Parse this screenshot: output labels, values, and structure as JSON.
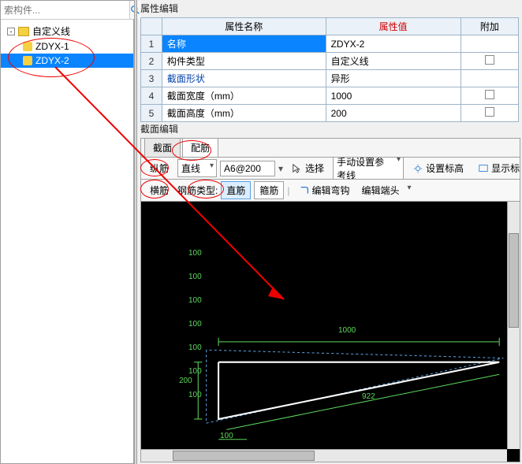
{
  "search": {
    "placeholder": "索构件..."
  },
  "tree": {
    "root_label": "自定义线",
    "children": [
      {
        "label": "ZDYX-1",
        "selected": false
      },
      {
        "label": "ZDYX-2",
        "selected": true
      }
    ]
  },
  "property_editor": {
    "title": "属性编辑",
    "headers": {
      "name": "属性名称",
      "value": "属性值",
      "extra": "附加"
    },
    "rows": [
      {
        "num": "1",
        "name": "名称",
        "value": "ZDYX-2",
        "selected": true,
        "has_checkbox": false
      },
      {
        "num": "2",
        "name": "构件类型",
        "value": "自定义线",
        "has_checkbox": true
      },
      {
        "num": "3",
        "name": "截面形状",
        "value": "异形",
        "link": true,
        "has_checkbox": false
      },
      {
        "num": "4",
        "name": "截面宽度（mm）",
        "value": "1000",
        "has_checkbox": true
      },
      {
        "num": "5",
        "name": "截面高度（mm）",
        "value": "200",
        "has_checkbox": true
      }
    ]
  },
  "section_editor": {
    "title": "截面编辑",
    "tabs": [
      {
        "label": "截面"
      },
      {
        "label": "配筋",
        "active": true
      }
    ],
    "toolbar1": {
      "rebar_vert": "纵筋",
      "line": "直线",
      "size_input": "A6@200",
      "select": "选择",
      "manual_ref": "手动设置参考线",
      "set_mark": "设置标高",
      "show_mark": "显示标"
    },
    "toolbar2": {
      "rebar_horz": "横筋",
      "rebar_type_label": "钢筋类型:",
      "straight": "直筋",
      "stirrup": "箍筋",
      "edit_hook": "编辑弯钩",
      "edit_end": "编辑端头"
    }
  },
  "drawing": {
    "dims": {
      "top": "1000",
      "left": "200",
      "bottom_small": "100",
      "diag": "922"
    },
    "y_labels": [
      "100",
      "100",
      "100",
      "100",
      "100",
      "100",
      "100"
    ]
  }
}
